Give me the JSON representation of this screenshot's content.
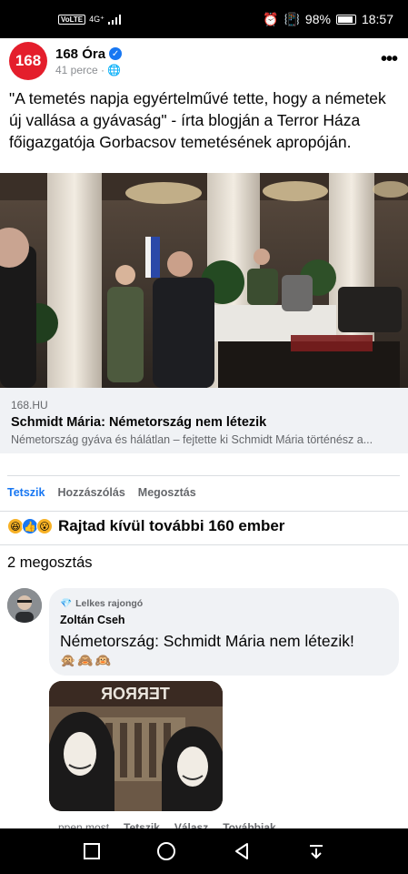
{
  "status_bar": {
    "network": "VoLTE",
    "signal": "4G⁺",
    "battery": "98%",
    "time": "18:57",
    "icons": [
      "alarm-icon",
      "vibrate-icon",
      "battery-icon"
    ]
  },
  "post": {
    "page_avatar_text": "168",
    "page_name": "168 Óra",
    "time": "41 perce",
    "audience_icon": "globe-icon",
    "text": "\"A temetés napja egyértelművé tette, hogy a németek új vallása a gyávaság\" - írta blogján a Terror Háza főigazgatója Gorbacsov temetésének apropóján.",
    "link": {
      "domain": "168.HU",
      "title": "Schmidt Mária: Németország nem létezik",
      "description": "Németország gyáva és hálátlan – fejtette ki Schmidt Mária történész a..."
    },
    "actions": {
      "like": "Tetszik",
      "comment": "Hozzászólás",
      "share": "Megosztás"
    },
    "reactions": {
      "icons": [
        "haha-icon",
        "like-icon",
        "wow-icon"
      ],
      "text": "Rajtad kívül további 160 ember"
    },
    "shares_text": "2 megosztás"
  },
  "comment": {
    "badge": "Lelkes rajongó",
    "author": "Zoltán Cseh",
    "text": "Németország: Schmidt Mária nem létezik!",
    "emojis": "🙊🙈🙉",
    "photo_sign": "ЯOЯЯƎT",
    "actions": {
      "time": "ppen most",
      "like": "Tetszik",
      "reply": "Válasz",
      "more": "Továbbiak"
    }
  },
  "colors": {
    "accent": "#1877f2",
    "brand": "#e41e2c",
    "secondary_text": "#65676b"
  }
}
